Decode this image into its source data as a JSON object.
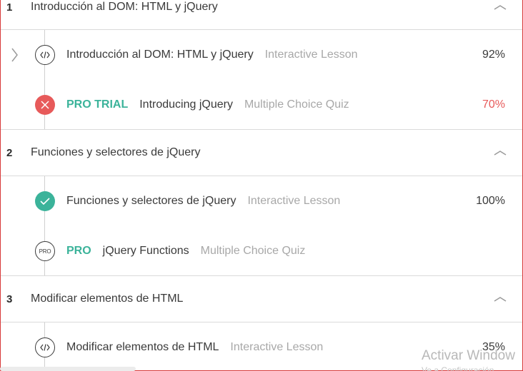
{
  "sections": [
    {
      "number": "1",
      "title": "Introducción al DOM: HTML y jQuery",
      "items": [
        {
          "badge": "",
          "title": "Introducción al DOM: HTML y jQuery",
          "type": "Interactive Lesson",
          "percent": "92%",
          "icon": "code-icon"
        },
        {
          "badge": "PRO TRIAL",
          "title": "Introducing jQuery",
          "type": "Multiple Choice Quiz",
          "percent": "70%",
          "icon": "failed-x-icon"
        }
      ]
    },
    {
      "number": "2",
      "title": "Funciones y selectores de jQuery",
      "items": [
        {
          "badge": "",
          "title": "Funciones y selectores de jQuery",
          "type": "Interactive Lesson",
          "percent": "100%",
          "icon": "checkmark-icon"
        },
        {
          "badge": "PRO",
          "title": "jQuery Functions",
          "type": "Multiple Choice Quiz",
          "percent": "",
          "icon": "pro-icon",
          "icon_text": "PRO"
        }
      ]
    },
    {
      "number": "3",
      "title": "Modificar elementos de HTML",
      "items": [
        {
          "badge": "",
          "title": "Modificar elementos de HTML",
          "type": "Interactive Lesson",
          "percent": "35%",
          "icon": "code-icon"
        }
      ]
    }
  ],
  "watermark": {
    "line1": "Activar Window",
    "line2": "Ve a Configuración"
  },
  "colors": {
    "accent_green": "#3bb39a",
    "fail_red": "#e75a5a",
    "muted": "#a8a8a8",
    "border_red": "#d83a3a"
  }
}
